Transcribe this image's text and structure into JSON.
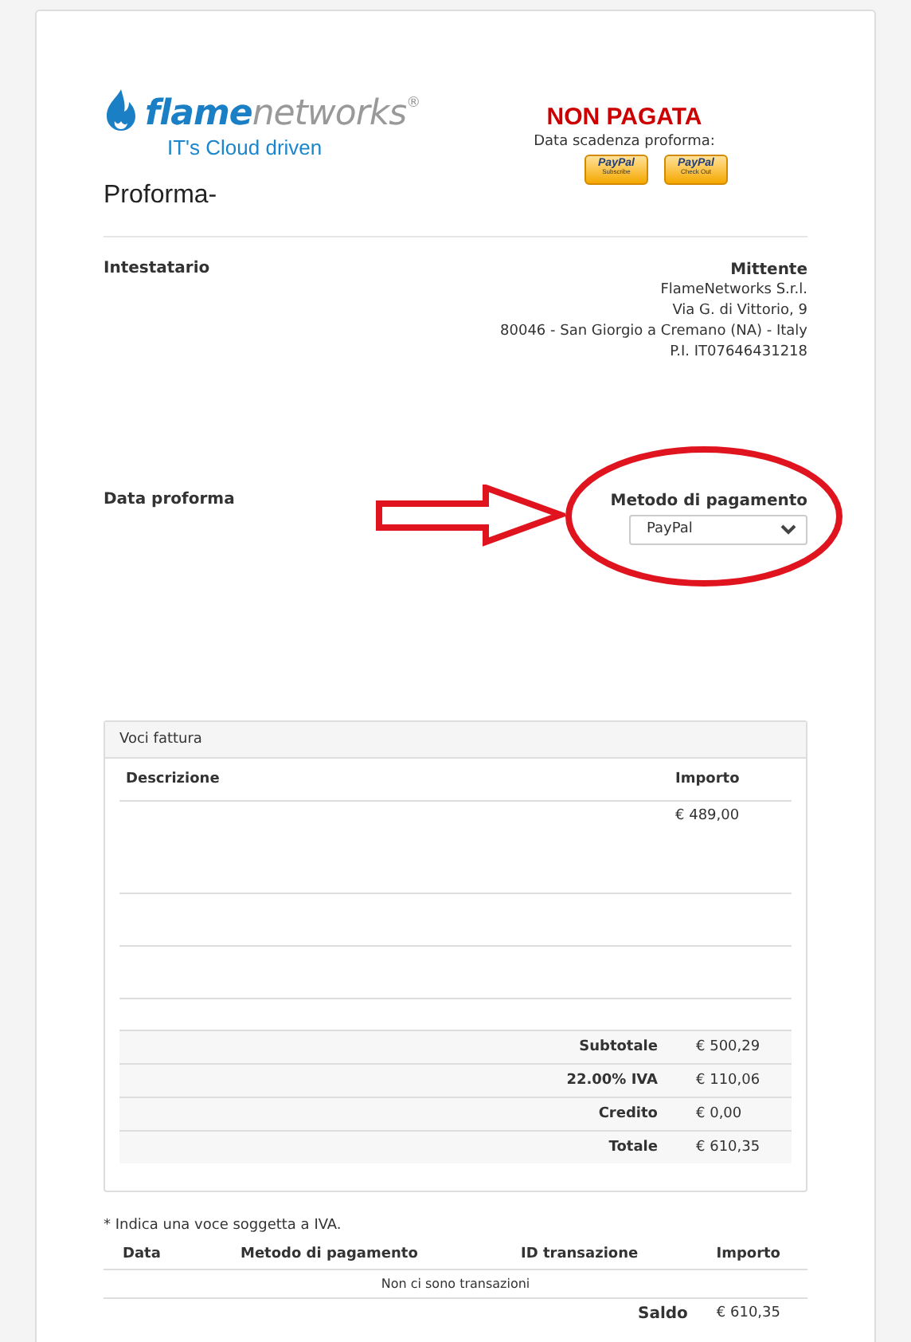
{
  "logo": {
    "brand_primary": "flame",
    "brand_secondary": "networks",
    "registered": "®",
    "tagline": "IT's Cloud driven"
  },
  "status": "NON PAGATA",
  "due_date_label": "Data scadenza proforma:",
  "paypal_buttons": [
    {
      "brand": "PayPal",
      "caption": "Subscribe"
    },
    {
      "brand": "PayPal",
      "caption": "Check Out"
    }
  ],
  "title": "Proforma-",
  "recipient": {
    "heading": "Intestatario"
  },
  "sender": {
    "heading": "Mittente",
    "lines": [
      "FlameNetworks S.r.l.",
      "Via G. di Vittorio, 9",
      "80046 - San Giorgio a Cremano (NA) - Italy",
      "P.I. IT07646431218"
    ]
  },
  "proforma_date": {
    "label": "Data proforma"
  },
  "payment_method": {
    "label": "Metodo di pagamento",
    "value": "PayPal"
  },
  "items_panel": {
    "title": "Voci fattura",
    "columns": [
      "Descrizione",
      "Importo"
    ],
    "rows": [
      {
        "amount": "€ 489,00"
      }
    ],
    "totals": [
      {
        "label": "Subtotale",
        "value": "€ 500,29"
      },
      {
        "label": "22.00% IVA",
        "value": "€ 110,06"
      },
      {
        "label": "Credito",
        "value": "€ 0,00"
      },
      {
        "label": "Totale",
        "value": "€ 610,35"
      }
    ]
  },
  "footnote": "* Indica una voce soggetta a IVA.",
  "transactions": {
    "columns": [
      "Data",
      "Metodo di pagamento",
      "ID transazione",
      "Importo"
    ],
    "empty_message": "Non ci sono transazioni",
    "balance_label": "Saldo",
    "balance": "€ 610,35"
  }
}
